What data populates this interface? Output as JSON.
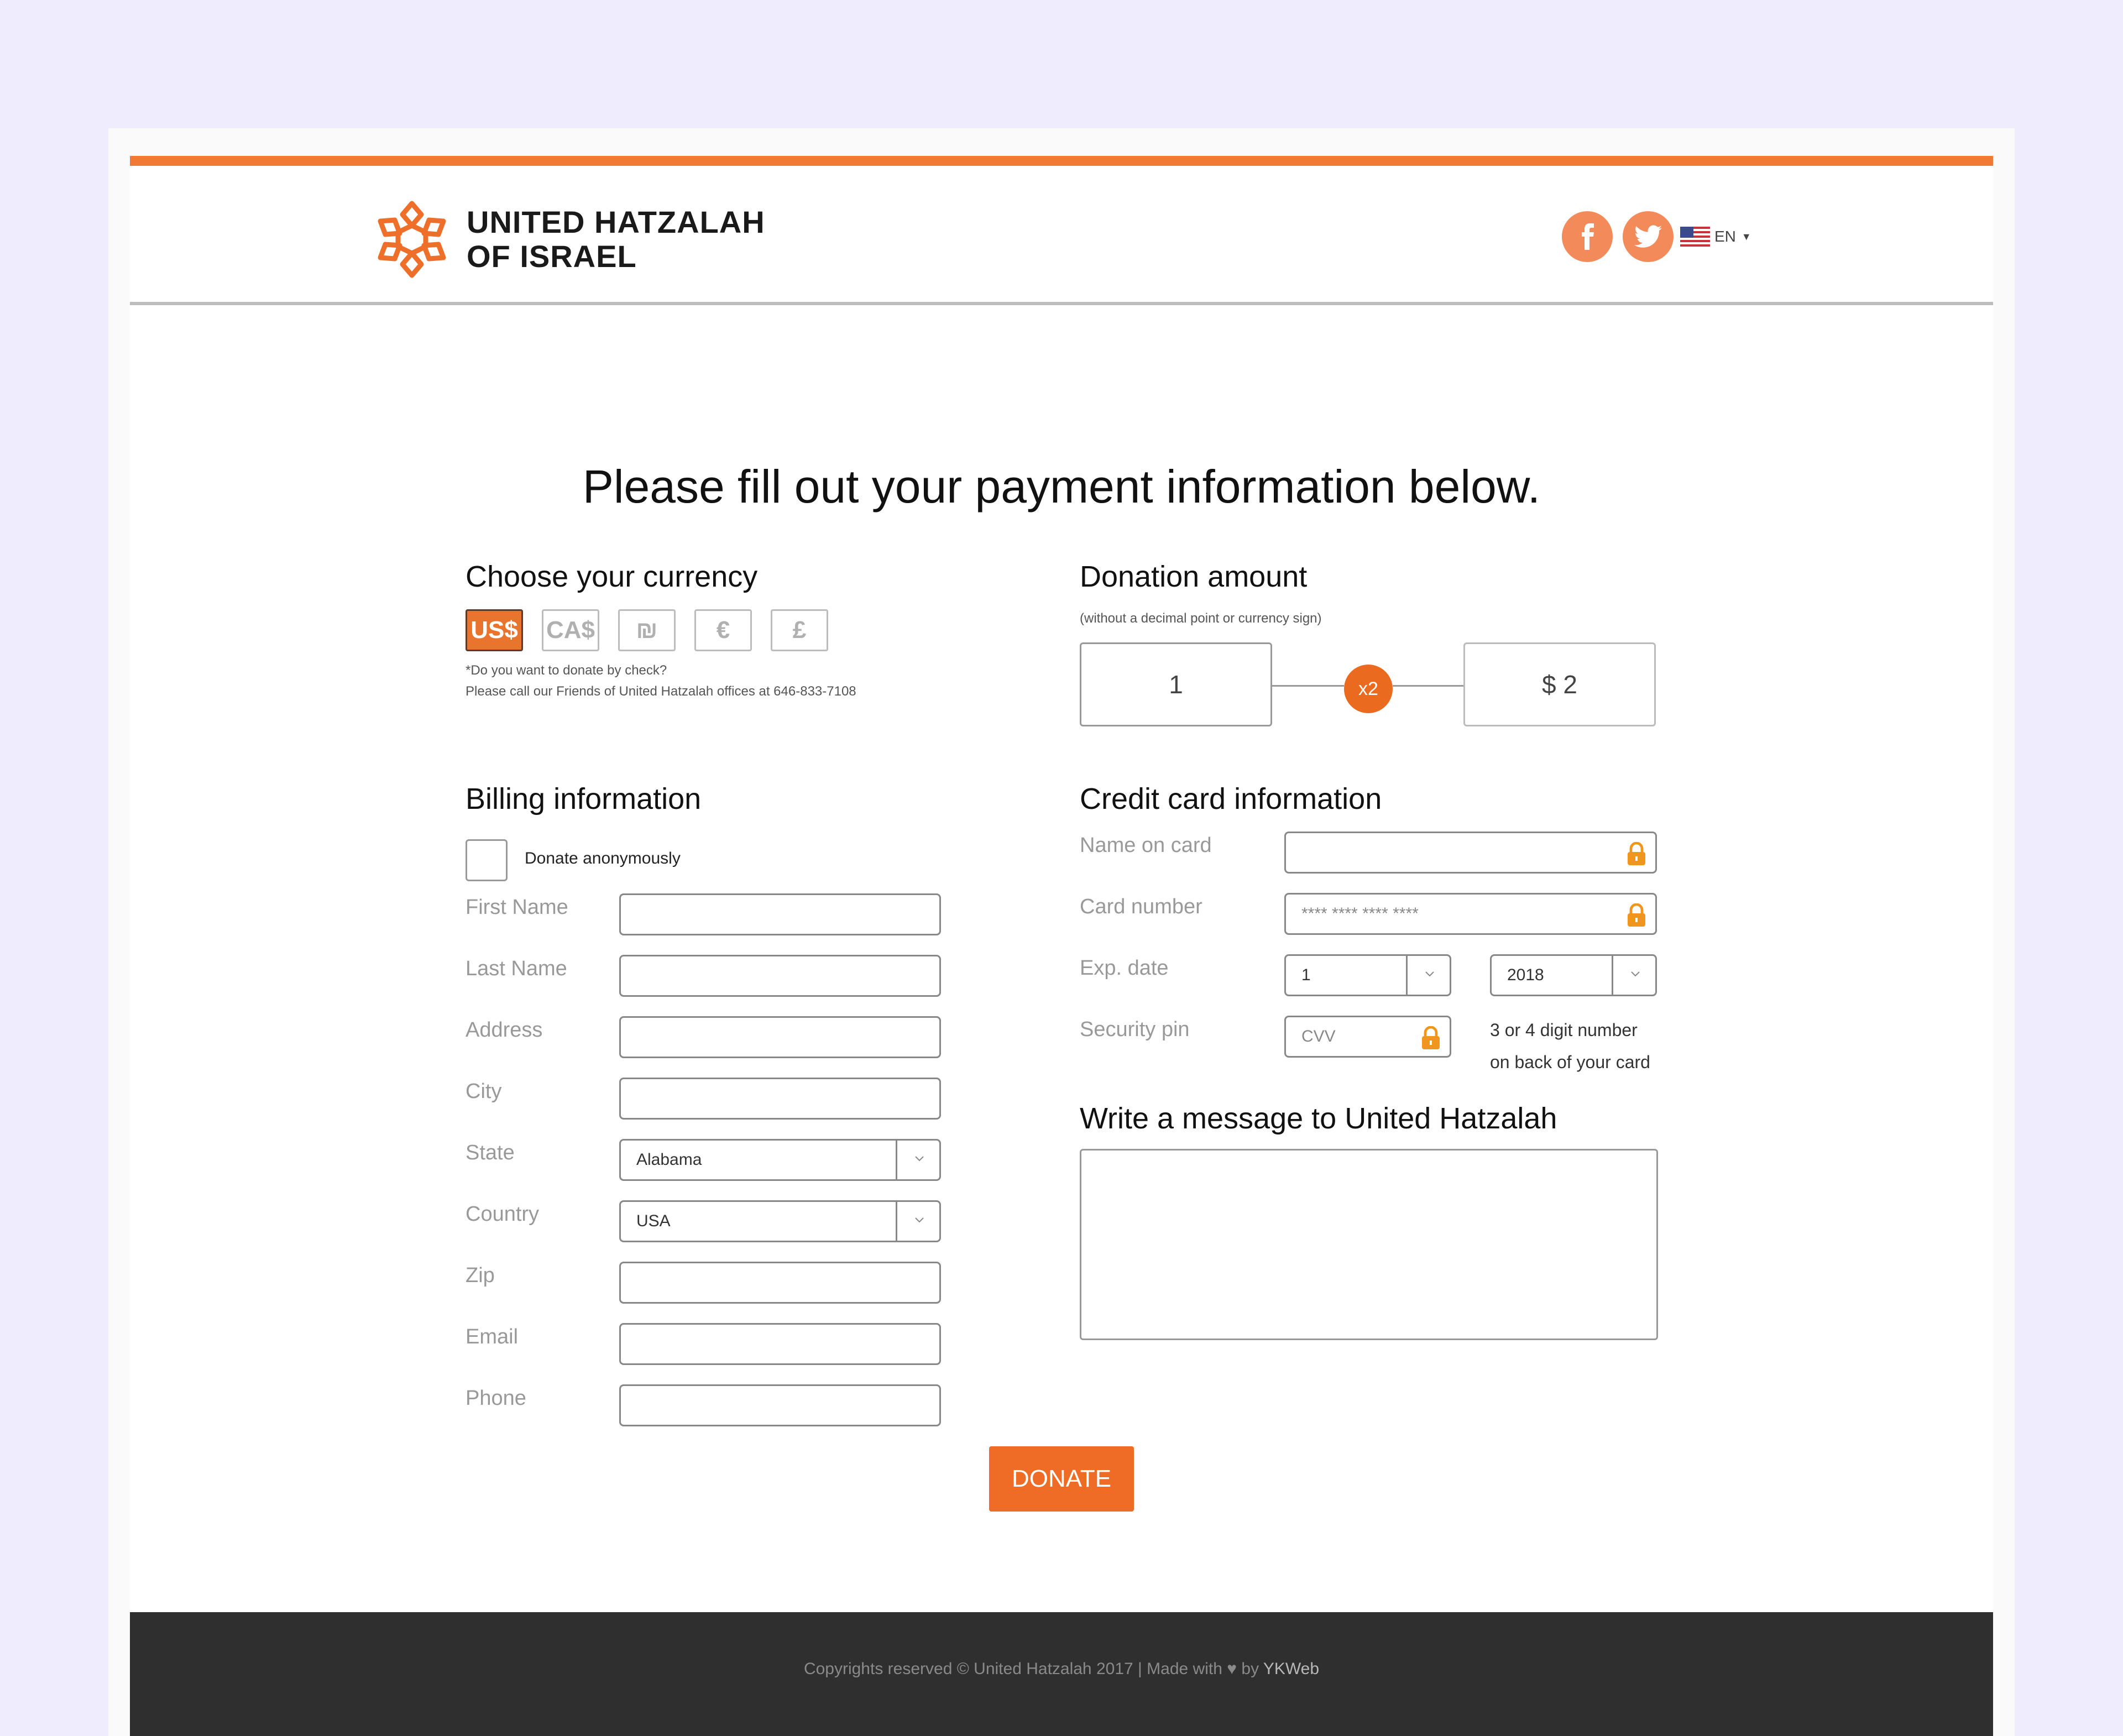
{
  "header": {
    "logo_line1": "UNITED HATZALAH",
    "logo_line2": "OF ISRAEL",
    "social": [
      "facebook-icon",
      "twitter-icon"
    ],
    "language": "EN",
    "accent_color": "#f07a35"
  },
  "main": {
    "title": "Please fill out your payment information below."
  },
  "currency": {
    "heading": "Choose your currency",
    "options": [
      "US$",
      "CA$",
      "₪",
      "€",
      "£"
    ],
    "selected": "US$",
    "note_line1": "*Do you want to donate by check?",
    "note_line2": "Please call our Friends of United Hatzalah offices at 646-833-7108"
  },
  "donation": {
    "heading": "Donation amount",
    "subtext": "(without a decimal point or currency sign)",
    "amount": "1",
    "multiplier": "x2",
    "total": "$ 2"
  },
  "billing": {
    "heading": "Billing information",
    "anonymous_label": "Donate anonymously",
    "anonymous_checked": false,
    "fields": {
      "first_name": "First Name",
      "last_name": "Last Name",
      "address": "Address",
      "city": "City",
      "state": "State",
      "country": "Country",
      "zip": "Zip",
      "email": "Email",
      "phone": "Phone"
    },
    "state_value": "Alabama",
    "country_value": "USA"
  },
  "card": {
    "heading": "Credit card information",
    "name_label": "Name on card",
    "number_label": "Card number",
    "number_placeholder": "**** **** **** ****",
    "exp_label": "Exp. date",
    "exp_month": "1",
    "exp_year": "2018",
    "pin_label": "Security pin",
    "cvv_placeholder": "CVV",
    "hint_line1": "3 or 4 digit number",
    "hint_line2": "on back of your card"
  },
  "message": {
    "heading": "Write a message to United Hatzalah"
  },
  "donate_button": "DONATE",
  "footer": {
    "text": "Copyrights reserved © United Hatzalah 2017 | Made with",
    "by": "by",
    "brand": "YKWeb"
  }
}
